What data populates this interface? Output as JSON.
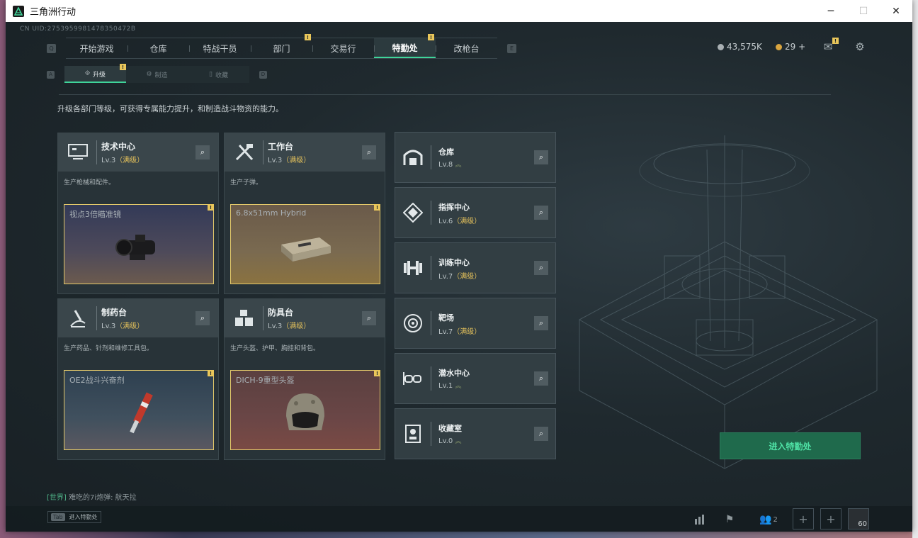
{
  "window": {
    "title": "三角洲行动",
    "controls": [
      "─",
      "☐",
      "✕"
    ]
  },
  "uid": "CN UID:2753959981478350472B",
  "nav": {
    "left_key": "Q",
    "right_key": "E",
    "tabs": [
      {
        "label": "开始游戏",
        "badge": ""
      },
      {
        "label": "仓库",
        "badge": ""
      },
      {
        "label": "特战干员",
        "badge": ""
      },
      {
        "label": "部门",
        "badge": "!"
      },
      {
        "label": "交易行",
        "badge": ""
      },
      {
        "label": "特勤处",
        "badge": "!",
        "active": true
      },
      {
        "label": "改枪台",
        "badge": ""
      }
    ]
  },
  "currency": {
    "coins": "43,575K",
    "tickets": "29 +"
  },
  "subnav": {
    "left_key": "A",
    "right_key": "D",
    "tabs": [
      {
        "label": "升级",
        "badge": "!",
        "active": true
      },
      {
        "label": "制造",
        "badge": ""
      },
      {
        "label": "收藏",
        "badge": ""
      }
    ]
  },
  "description": "升级各部门等级，可获得专属能力提升，和制造战斗物资的能力。",
  "production_cards": [
    {
      "name": "技术中心",
      "level": "Lv.3",
      "max": "（满级）",
      "text": "生产枪械和配件。",
      "product": "视点3倍瞄准镜",
      "badge": "!",
      "icon": "monitor-icon"
    },
    {
      "name": "工作台",
      "level": "Lv.3",
      "max": "（满级）",
      "text": "生产子弹。",
      "product": "6.8x51mm Hybrid",
      "badge": "!",
      "icon": "tools-icon"
    },
    {
      "name": "制药台",
      "level": "Lv.3",
      "max": "（满级）",
      "text": "生产药品、针剂和维修工具包。",
      "product": "OE2战斗兴奋剂",
      "badge": "!",
      "icon": "microscope-icon"
    },
    {
      "name": "防具台",
      "level": "Lv.3",
      "max": "（满级）",
      "text": "生产头盔、护甲、胸挂和背包。",
      "product": "DICH-9重型头盔",
      "badge": "!",
      "icon": "boxes-icon"
    }
  ],
  "facility_cards": [
    {
      "name": "仓库",
      "level": "Lv.8",
      "max": "",
      "up": "︽",
      "icon": "warehouse-icon"
    },
    {
      "name": "指挥中心",
      "level": "Lv.6",
      "max": "（满级）",
      "up": "",
      "icon": "command-icon"
    },
    {
      "name": "训练中心",
      "level": "Lv.7",
      "max": "（满级）",
      "up": "",
      "icon": "dumbbell-icon"
    },
    {
      "name": "靶场",
      "level": "Lv.7",
      "max": "（满级）",
      "up": "",
      "icon": "target-icon"
    },
    {
      "name": "潜水中心",
      "level": "Lv.1",
      "max": "",
      "up": "︽",
      "icon": "goggles-icon"
    },
    {
      "name": "收藏室",
      "level": "Lv.0",
      "max": "",
      "up": "︽",
      "icon": "vault-icon"
    }
  ],
  "enter_button": "进入特勤处",
  "chat": {
    "channel": "[世界]",
    "message": " 难吃的7i炮弹: 航天拉"
  },
  "tab_hint": {
    "key": "Tab",
    "label": "进入特勤处"
  },
  "bottom": {
    "party_count": "2",
    "level": "60"
  }
}
